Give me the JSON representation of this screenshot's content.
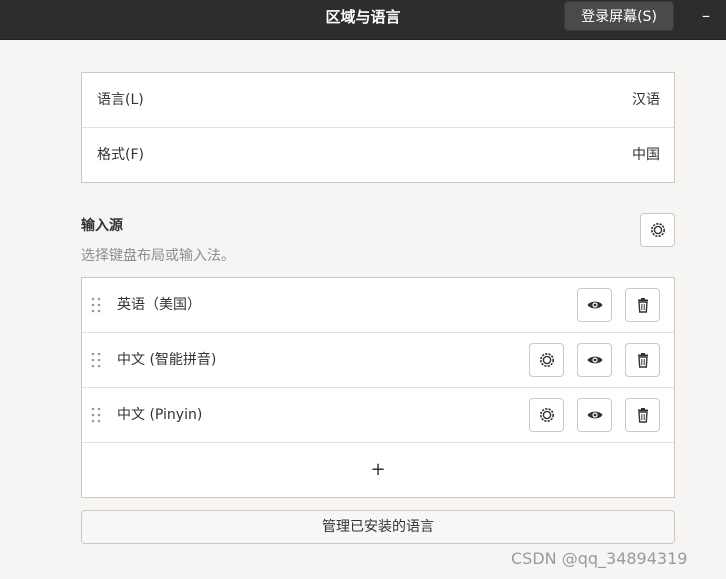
{
  "window": {
    "title": "区域与语言",
    "login_screen_button": "登录屏幕(S)",
    "minimize_symbol": "–"
  },
  "locale": {
    "rows": [
      {
        "label": "语言(L)",
        "value": "汉语"
      },
      {
        "label": "格式(F)",
        "value": "中国"
      }
    ]
  },
  "input_sources": {
    "title": "输入源",
    "subtitle": "选择键盘布局或输入法。",
    "items": [
      {
        "label": "英语（美国）",
        "has_settings": false
      },
      {
        "label": "中文 (智能拼音)",
        "has_settings": true
      },
      {
        "label": "中文 (Pinyin)",
        "has_settings": true
      }
    ],
    "add_symbol": "+"
  },
  "manage_languages_button": "管理已安装的语言",
  "watermark": "CSDN @qq_34894319",
  "icons": {
    "settings": "gear-icon",
    "preview": "eye-icon",
    "remove": "trash-icon",
    "drag": "drag-handle-icon"
  },
  "colors": {
    "titlebar_bg": "#2d2d2d",
    "window_bg": "#f6f5f4",
    "panel_bg": "#ffffff",
    "border": "#cdc7c2"
  }
}
